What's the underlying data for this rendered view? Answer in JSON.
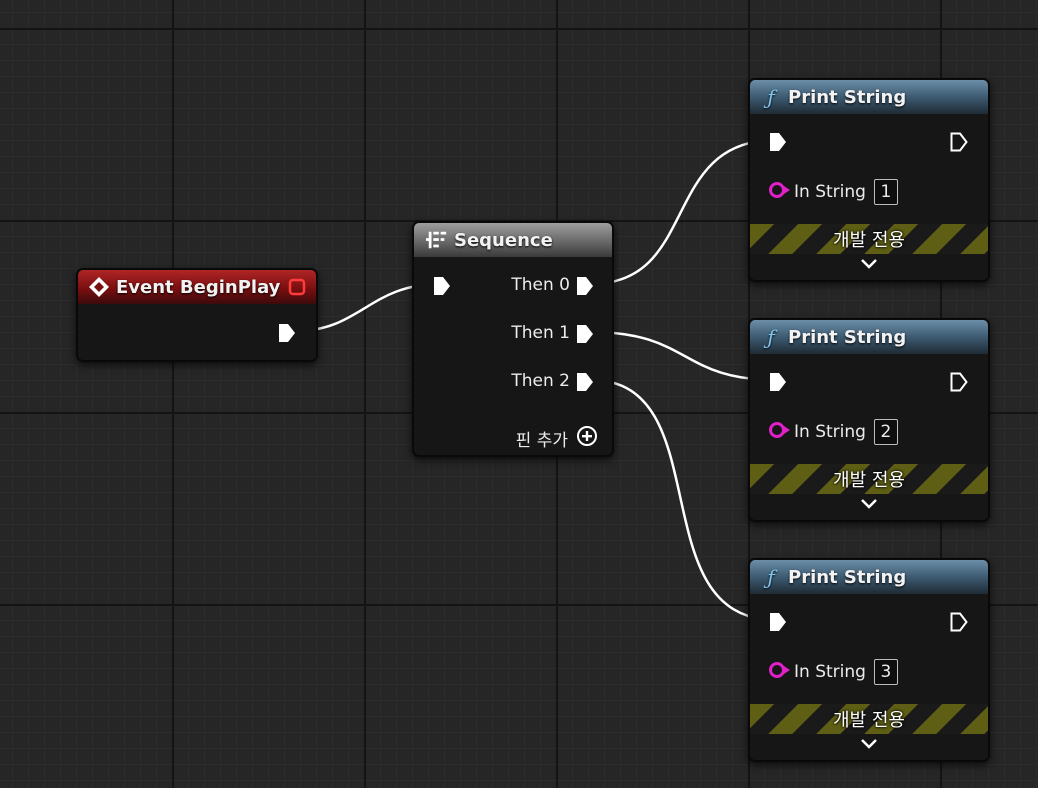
{
  "event_node": {
    "title": "Event BeginPlay",
    "icon": "event-diamond-icon"
  },
  "sequence_node": {
    "title": "Sequence",
    "icon": "sequence-icon",
    "outputs": [
      "Then 0",
      "Then 1",
      "Then 2"
    ],
    "add_pin_label": "핀 추가"
  },
  "print_nodes": [
    {
      "title": "Print String",
      "param_label": "In String",
      "value": "1",
      "dev_only_label": "개발 전용"
    },
    {
      "title": "Print String",
      "param_label": "In String",
      "value": "2",
      "dev_only_label": "개발 전용"
    },
    {
      "title": "Print String",
      "param_label": "In String",
      "value": "3",
      "dev_only_label": "개발 전용"
    }
  ],
  "colors": {
    "background": "#262626",
    "event_header": "#8a1516",
    "sequence_header": "#707070",
    "function_header": "#3d5b72",
    "string_pin": "#e020c8",
    "exec_wire": "#ffffff",
    "dev_stripe": "#5e5e14"
  }
}
